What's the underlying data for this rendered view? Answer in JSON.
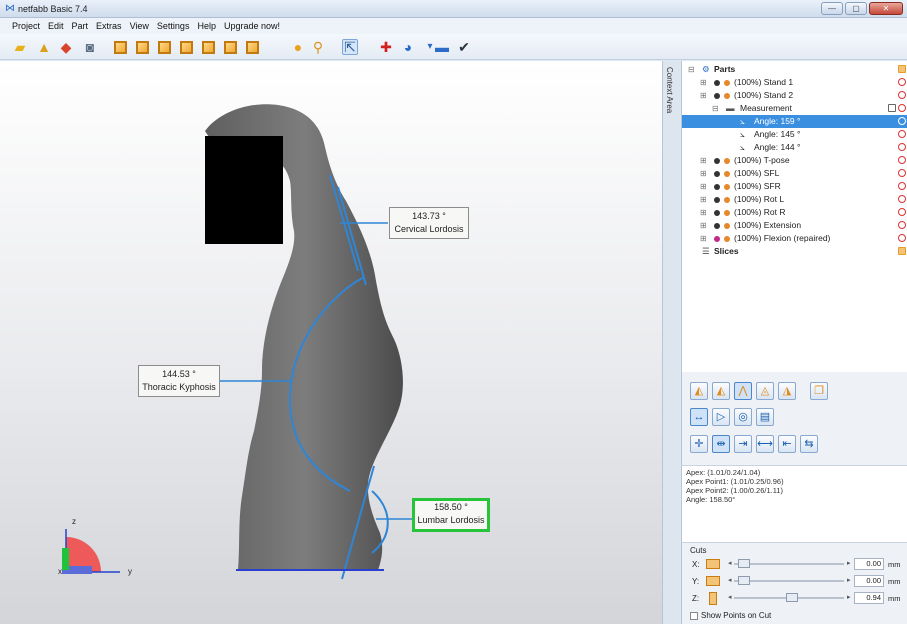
{
  "window": {
    "title": "netfabb Basic 7.4",
    "controls": [
      "—",
      "▢",
      "✕"
    ]
  },
  "menu": [
    "Project",
    "Edit",
    "Part",
    "Extras",
    "View",
    "Settings",
    "Help",
    "Upgrade now!"
  ],
  "toolbar": {
    "icons": [
      "open-folder-icon",
      "shapes-icon",
      "repair-ring-icon",
      "camera-icon",
      "view-front-cube-icon",
      "view-back-cube-icon",
      "view-left-cube-icon",
      "view-right-cube-icon",
      "view-top-cube-icon",
      "view-bottom-cube-icon",
      "view-iso-cube-icon",
      "sphere-icon",
      "zoom-icon",
      "select-pointer-icon",
      "red-cross-icon",
      "measure-icon",
      "minus-icon",
      "check-icon"
    ]
  },
  "viewport": {
    "annotations": [
      {
        "value": "143.73 °",
        "label": "Cervical Lordosis"
      },
      {
        "value": "144.53 °",
        "label": "Thoracic Kyphosis"
      },
      {
        "value": "158.50 °",
        "label": "Lumbar Lordosis"
      }
    ],
    "axes": {
      "z": "z",
      "y": "y",
      "x": "x"
    }
  },
  "context_tab": "Context Area",
  "tree": {
    "rows": [
      {
        "label": "Parts",
        "bold": true
      },
      {
        "label": "(100%) Stand 1"
      },
      {
        "label": "(100%) Stand 2"
      },
      {
        "label": "Measurement"
      },
      {
        "label": "Angle: 159 °",
        "selected": true
      },
      {
        "label": "Angle: 145 °"
      },
      {
        "label": "Angle: 144 °"
      },
      {
        "label": "(100%) T-pose"
      },
      {
        "label": "(100%) SFL"
      },
      {
        "label": "(100%) SFR"
      },
      {
        "label": "(100%) Rot L"
      },
      {
        "label": "(100%) Rot R"
      },
      {
        "label": "(100%) Extension"
      },
      {
        "label": "(100%) Flexion (repaired)"
      },
      {
        "label": "Slices",
        "bold": true
      }
    ]
  },
  "info": {
    "lines": [
      "Apex: (1.01/0.24/1.04)",
      "Apex Point1: (1.01/0.25/0.96)",
      "Apex Point2: (1.00/0.26/1.11)",
      "Angle: 158.50°"
    ]
  },
  "cuts": {
    "title": "Cuts",
    "rows": [
      {
        "axis": "X:",
        "value": "0.00",
        "unit": "mm"
      },
      {
        "axis": "Y:",
        "value": "0.00",
        "unit": "mm"
      },
      {
        "axis": "Z:",
        "value": "0.94",
        "unit": "mm"
      }
    ],
    "show_points": "Show Points on Cut"
  }
}
